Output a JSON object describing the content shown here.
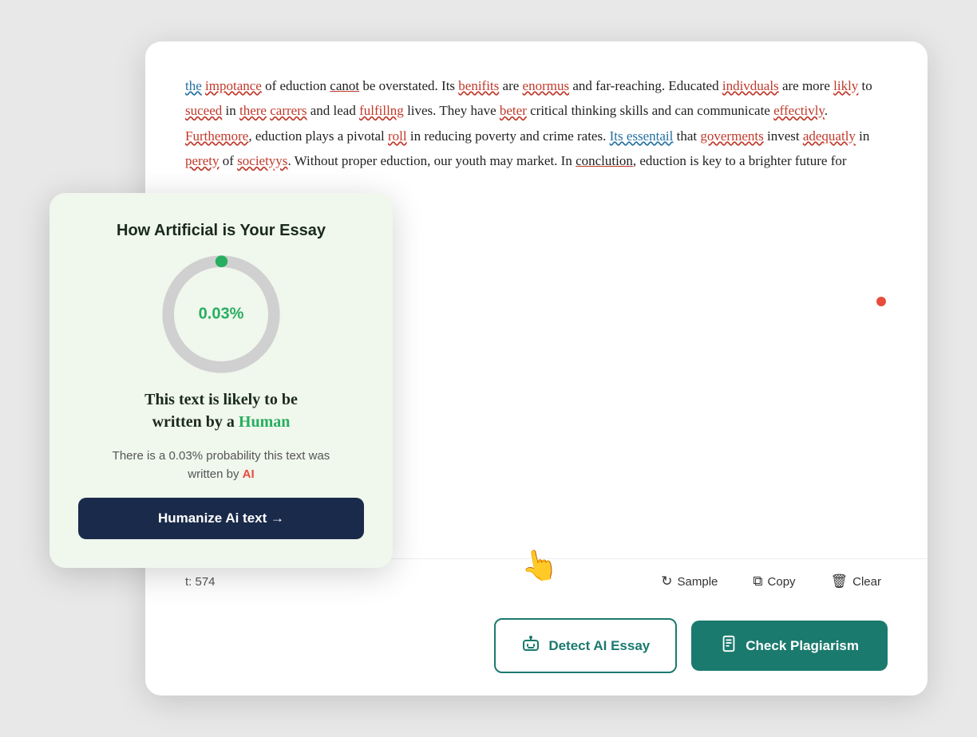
{
  "page": {
    "title": "AI Essay Detector"
  },
  "text_content": {
    "paragraph": "the impotance of eduction canot be overstated. Its benifits are enormus and far-reaching. Educated indivduals are more likly to suceed in there carrers and lead fulfillng lives. They have beter critical thinking skills and can communicate effectivly. Furthemore, eduction plays a pivotal roll in reducing poverty and crime rates. Its essentail that goverments invest adequatly in perety of societyys. Without proper eduction, our youth may market. In conclution, eduction is key to a brighter future for"
  },
  "bottom_bar": {
    "word_count_label": "t: 574",
    "sample_label": "Sample",
    "copy_label": "Copy",
    "clear_label": "Clear"
  },
  "action_buttons": {
    "detect_label": "Detect AI Essay",
    "plagiarism_label": "Check Plagiarism"
  },
  "ai_card": {
    "title": "How Artificial is Your Essay",
    "percentage": "0.03%",
    "human_text_line1": "This text is likely to be",
    "human_text_line2": "written by a",
    "human_word": "Human",
    "probability_line1": "There is a 0.03% probability this text was",
    "probability_line2": "written by",
    "ai_word": "AI",
    "humanize_label": "Humanize Ai text →"
  },
  "donut": {
    "human_pct": 99.97,
    "ai_pct": 0.03,
    "color_human": "#d0d0d0",
    "color_ai": "#27ae60"
  }
}
